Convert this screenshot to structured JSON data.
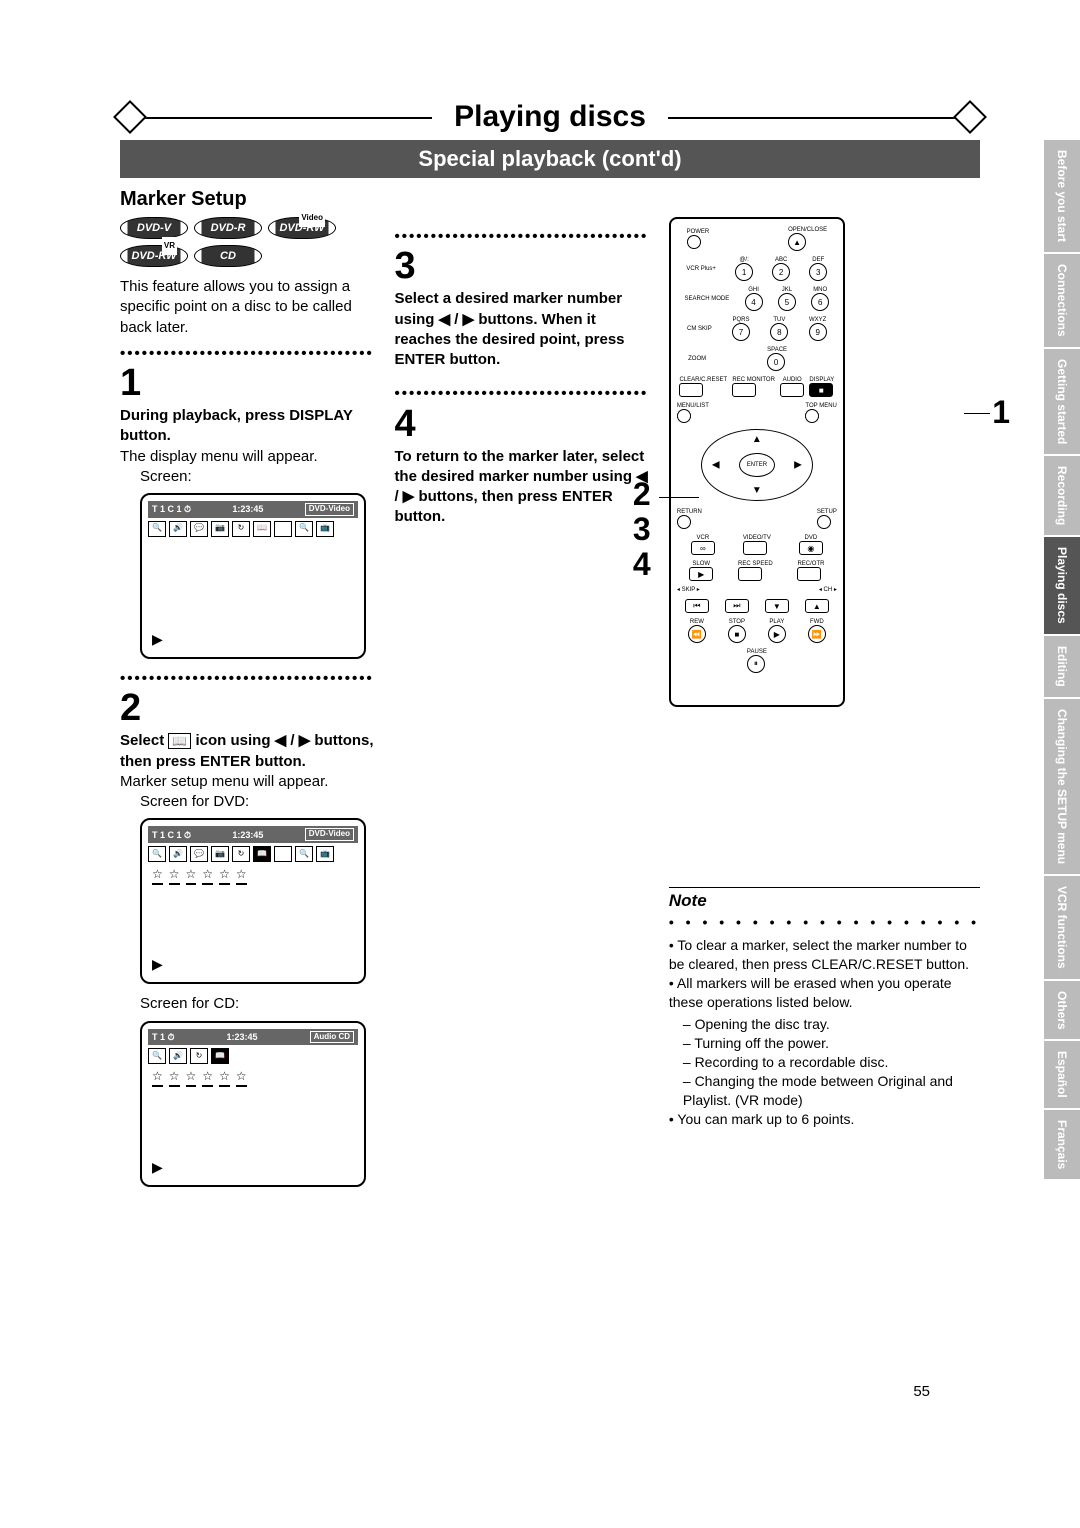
{
  "chapter": "Playing discs",
  "sub_chapter": "Special playback (cont'd)",
  "section": "Marker Setup",
  "badges": [
    "DVD-V",
    "DVD-R",
    "DVD-RW",
    "DVD-RW",
    "CD"
  ],
  "badge_sup": [
    "",
    "",
    "Video",
    "VR",
    ""
  ],
  "intro": "This feature allows you to assign a specific point on a disc to be called back later.",
  "steps_left": {
    "s1": {
      "num": "1",
      "bold": "During playback, press DISPLAY button.",
      "body": "The display menu will appear.",
      "caption": "Screen:"
    },
    "s2": {
      "num": "2",
      "bold_pre": "Select ",
      "bold_post": " icon using ◀ / ▶ buttons, then press ENTER button.",
      "body": "Marker setup menu will appear.",
      "caption1": "Screen for DVD:",
      "caption2": "Screen for CD:"
    }
  },
  "steps_mid": {
    "s3": {
      "num": "3",
      "bold": "Select a desired marker number using ◀ / ▶ buttons. When it reaches the desired point, press ENTER button."
    },
    "s4": {
      "num": "4",
      "bold": "To return to the marker later, select the desired marker number using ◀ / ▶ buttons, then press ENTER button."
    }
  },
  "screen1": {
    "left": "T   1  C   1 ⏱",
    "time": "1:23:45",
    "tag": "DVD-Video"
  },
  "screen2": {
    "left": "T   1  C   1 ⏱",
    "time": "1:23:45",
    "tag": "DVD-Video"
  },
  "screen3": {
    "left": "T   1 ⏱",
    "time": "1:23:45",
    "tag": "Audio CD"
  },
  "remote": {
    "top": [
      "POWER",
      "OPEN/CLOSE"
    ],
    "numrow_labels": [
      [
        "VCR Plus+",
        "@/:",
        "ABC",
        "DEF"
      ],
      [
        "SEARCH MODE",
        "GHI",
        "JKL",
        "MNO"
      ],
      [
        "CM SKIP",
        "PQRS",
        "TUV",
        "WXYZ"
      ],
      [
        "ZOOM",
        "",
        "SPACE",
        ""
      ]
    ],
    "midrow": [
      "CLEAR/C.RESET",
      "REC MONITOR",
      "AUDIO",
      "DISPLAY"
    ],
    "menu": [
      "MENU/LIST",
      "TOP MENU"
    ],
    "enter": "ENTER",
    "ret": [
      "RETURN",
      "SETUP"
    ],
    "src": [
      "VCR",
      "VIDEO/TV",
      "DVD"
    ],
    "trans": [
      "SLOW",
      "REC SPEED",
      "REC/OTR"
    ],
    "skip": [
      "SKIP",
      "CH"
    ],
    "bot": [
      "REW",
      "STOP",
      "PLAY",
      "FWD",
      "PAUSE"
    ]
  },
  "callouts": {
    "right": "1",
    "left": "2\n3\n4"
  },
  "note": {
    "title": "Note",
    "items": [
      "To clear a marker, select the marker number to be cleared, then press CLEAR/C.RESET button.",
      "All markers will be erased when you operate these operations listed below.",
      "You can mark up to 6 points."
    ],
    "subitems": [
      "Opening the disc tray.",
      "Turning off the power.",
      "Recording to a recordable disc.",
      "Changing the mode between Original and Playlist. (VR mode)"
    ]
  },
  "side_tabs": [
    "Before you start",
    "Connections",
    "Getting started",
    "Recording",
    "Playing discs",
    "Editing",
    "Changing the SETUP menu",
    "VCR functions",
    "Others",
    "Español",
    "Français"
  ],
  "side_dark_index": 4,
  "page_number": "55"
}
